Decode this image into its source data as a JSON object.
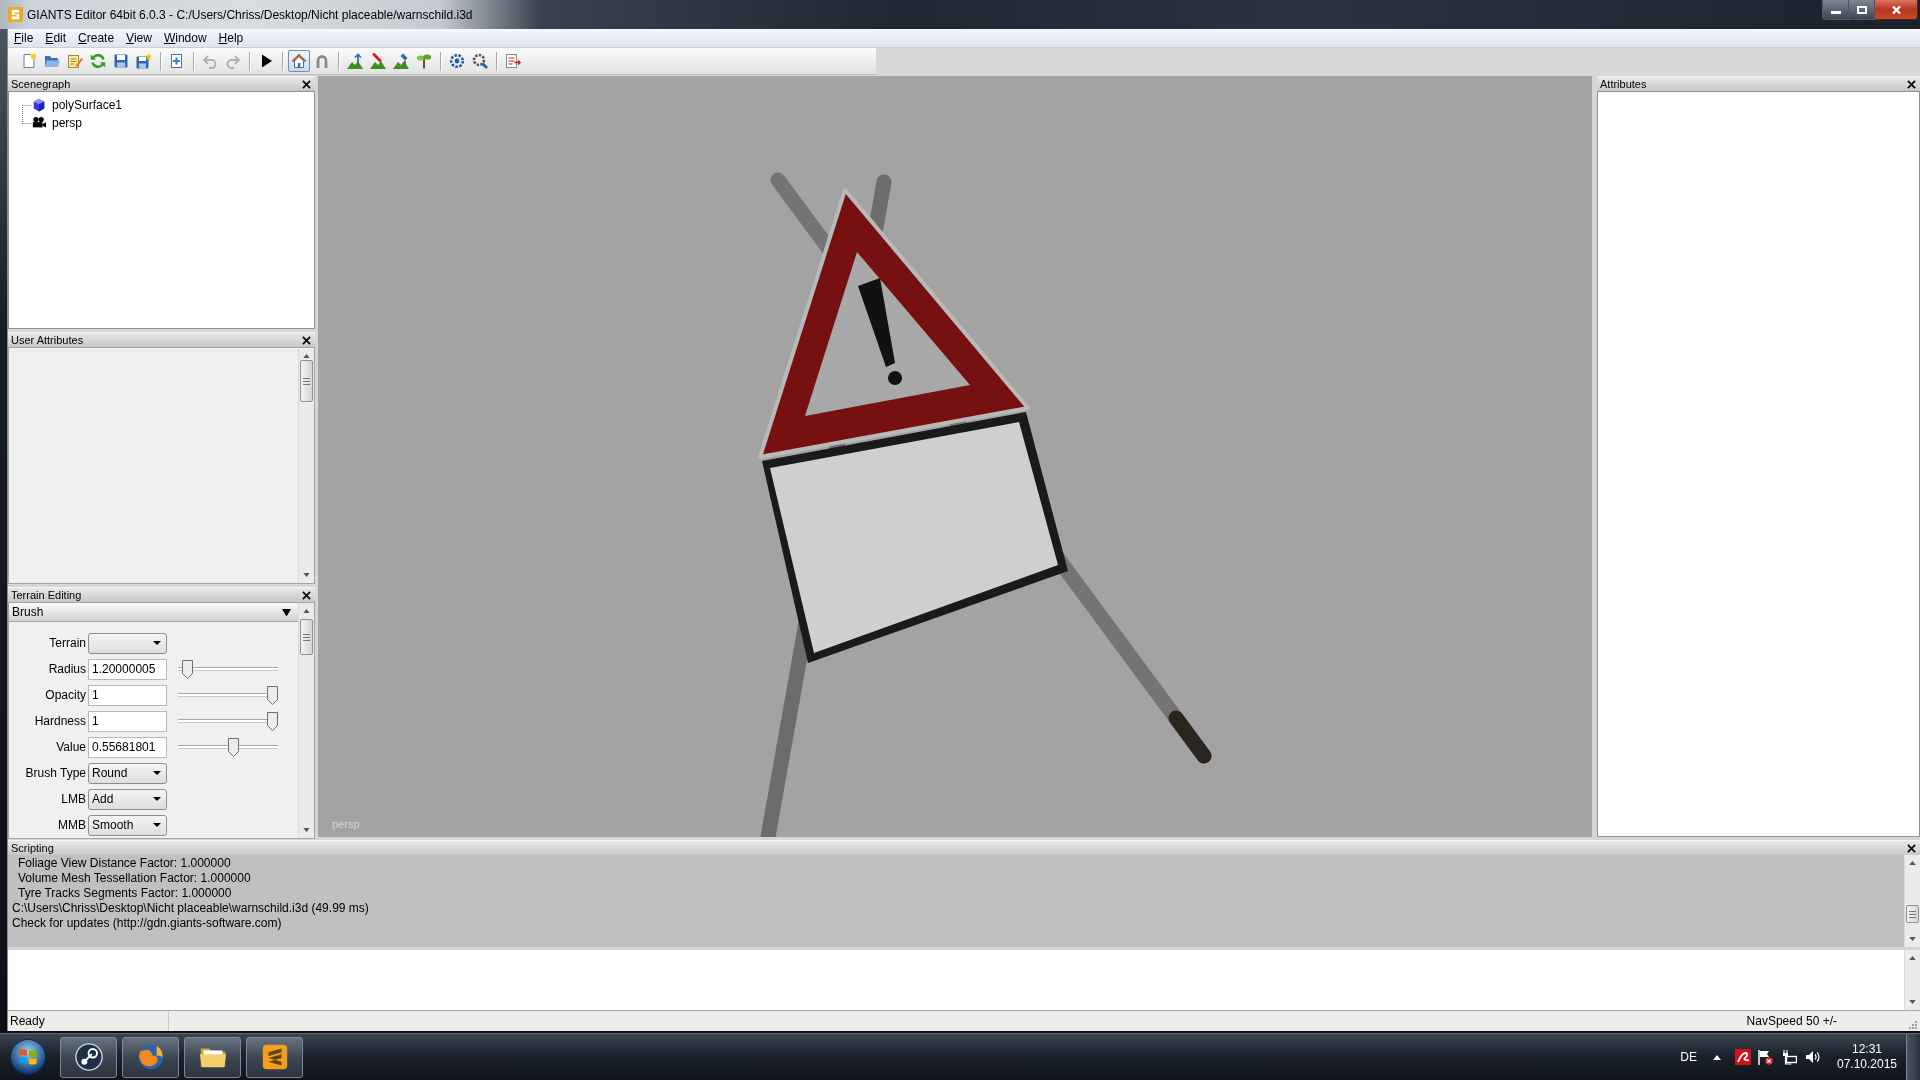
{
  "window": {
    "title": "GIANTS Editor 64bit 6.0.3 - C:/Users/Chriss/Desktop/Nicht placeable/warnschild.i3d"
  },
  "menu": [
    "File",
    "Edit",
    "Create",
    "View",
    "Window",
    "Help"
  ],
  "toolbar": [
    {
      "buttons": [
        {
          "selected": false,
          "disabled": false
        },
        {
          "selected": false,
          "disabled": false
        },
        {
          "selected": false,
          "disabled": false
        },
        {
          "selected": false,
          "disabled": false
        },
        {
          "selected": false,
          "disabled": false
        },
        {
          "selected": false,
          "disabled": false
        }
      ]
    },
    {
      "buttons": [
        {
          "selected": false,
          "disabled": false
        }
      ]
    },
    {
      "buttons": [
        {
          "selected": false,
          "disabled": true
        },
        {
          "selected": false,
          "disabled": true
        }
      ]
    },
    {
      "buttons": [
        {
          "selected": false,
          "disabled": false
        }
      ]
    },
    {
      "buttons": [
        {
          "selected": true,
          "disabled": false
        },
        {
          "selected": false,
          "disabled": false
        }
      ]
    },
    {
      "buttons": [
        {
          "selected": false,
          "disabled": false
        },
        {
          "selected": false,
          "disabled": false
        },
        {
          "selected": false,
          "disabled": false
        },
        {
          "selected": false,
          "disabled": false
        }
      ]
    },
    {
      "buttons": [
        {
          "selected": false,
          "disabled": false
        },
        {
          "selected": false,
          "disabled": false
        }
      ]
    },
    {
      "buttons": [
        {
          "selected": false,
          "disabled": false
        }
      ]
    }
  ],
  "scenegraph": {
    "title": "Scenegraph",
    "nodes": [
      {
        "kind": "shape",
        "label": "polySurface1"
      },
      {
        "kind": "camera",
        "label": "persp"
      }
    ]
  },
  "user_attributes": {
    "title": "User Attributes"
  },
  "terrain_editing": {
    "title": "Terrain Editing",
    "section": {
      "title": "Brush",
      "expanded": true
    },
    "rows": [
      {
        "kind": "select",
        "label": "Terrain"
      },
      {
        "kind": "number",
        "label": "Radius",
        "value": "1.20000005",
        "level": 0.05
      },
      {
        "kind": "number",
        "label": "Opacity",
        "value": "1",
        "level": 1
      },
      {
        "kind": "number",
        "label": "Hardness",
        "value": "1",
        "level": 1
      },
      {
        "kind": "number",
        "label": "Value",
        "value": "0.55681801",
        "level": 0.56
      },
      {
        "kind": "select",
        "label": "Brush Type",
        "value": "Round"
      },
      {
        "kind": "select",
        "label": "LMB",
        "value": "Add"
      },
      {
        "kind": "select",
        "label": "MMB",
        "value": "Smooth"
      }
    ]
  },
  "viewport": {
    "camera": "persp"
  },
  "attributes": {
    "title": "Attributes"
  },
  "scripting": {
    "title": "Scripting",
    "lines": [
      {
        "text": "Foliage View Distance Factor: 1.000000",
        "indented": true
      },
      {
        "text": "Volume Mesh Tessellation Factor: 1.000000",
        "indented": true
      },
      {
        "text": "Tyre Tracks Segments Factor: 1.000000",
        "indented": true
      },
      {
        "text": "C:\\Users\\Chriss\\Desktop\\Nicht placeable\\warnschild.i3d (49.99 ms)",
        "indented": false
      },
      {
        "text": "Check for updates (http://gdn.giants-software.com)",
        "indented": false
      }
    ]
  },
  "status_bar": {
    "message": "Ready",
    "nav_speed": "NavSpeed 50 +/-"
  },
  "taskbar": {
    "language": "DE",
    "time": "12:31",
    "date": "07.10.2015"
  }
}
